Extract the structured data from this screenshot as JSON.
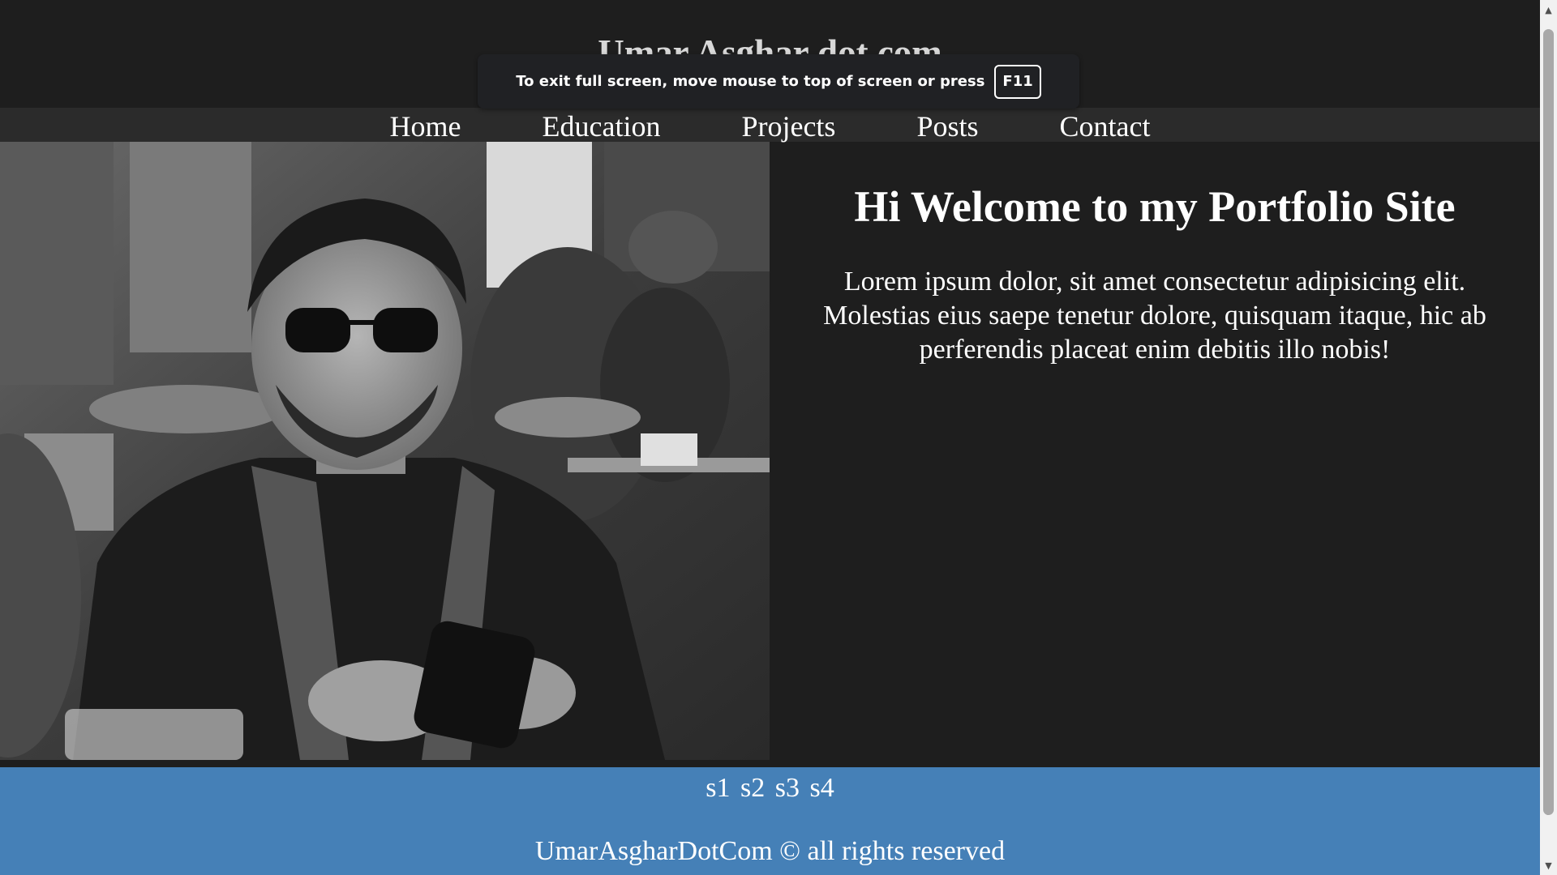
{
  "header": {
    "site_title": "Umar Asghar dot com"
  },
  "fullscreen_notice": {
    "message": "To exit full screen, move mouse to top of screen or press",
    "key": "F11"
  },
  "nav": {
    "items": [
      {
        "label": "Home"
      },
      {
        "label": "Education"
      },
      {
        "label": "Projects"
      },
      {
        "label": "Posts"
      },
      {
        "label": "Contact"
      }
    ]
  },
  "hero": {
    "photo_icon": "portrait-photo",
    "heading": "Hi Welcome to my Portfolio Site",
    "text": "Lorem ipsum dolor, sit amet consectetur adipisicing elit. Molestias eius saepe tenetur dolore, quisquam itaque, hic ab perferendis placeat enim debitis illo nobis!"
  },
  "footer": {
    "social": [
      "s1",
      "s2",
      "s3",
      "s4"
    ],
    "copyright": "UmarAsgharDotCom © all rights reserved"
  },
  "colors": {
    "background": "#1e1e1e",
    "nav_background": "#2b2b2b",
    "footer_background": "#4580b7",
    "text": "#ffffff"
  }
}
